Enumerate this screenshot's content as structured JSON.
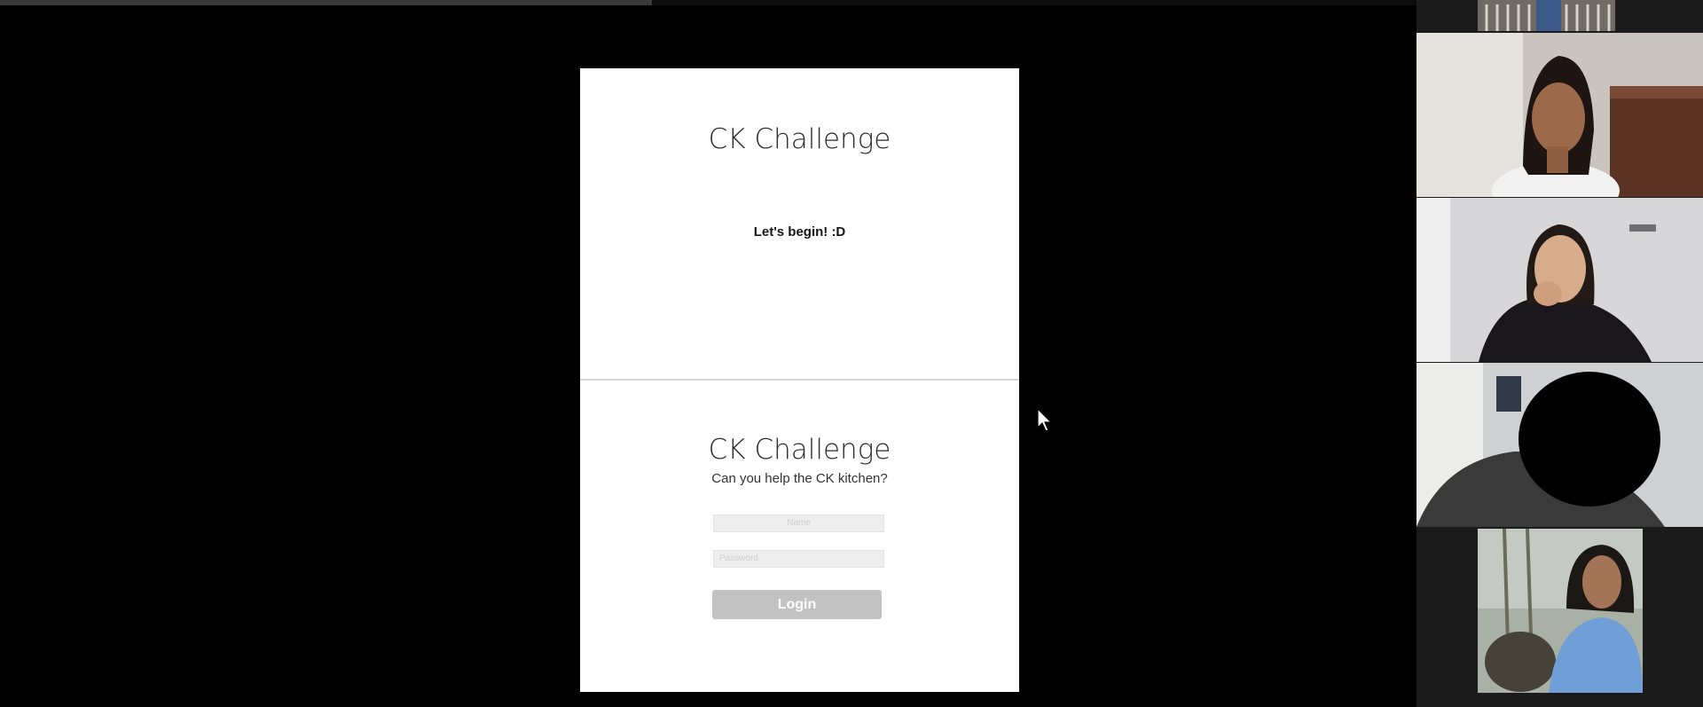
{
  "screen_share": {
    "playback_progress": 0.46,
    "slide_top": {
      "title": "CK Challenge",
      "subtitle": "Let's begin! :D"
    },
    "slide_bottom": {
      "title": "CK Challenge",
      "subtitle": "Can you help the CK kitchen?",
      "username_placeholder": "Name",
      "password_placeholder": "Password",
      "login_label": "Login"
    }
  },
  "participants": [
    {
      "role": "video-tile",
      "kind": "partial-top"
    },
    {
      "role": "video-tile",
      "kind": "speaker"
    },
    {
      "role": "video-tile",
      "kind": "participant"
    },
    {
      "role": "video-tile",
      "kind": "redacted"
    },
    {
      "role": "video-tile",
      "kind": "participant"
    }
  ],
  "colors": {
    "background": "#000000",
    "slide_background": "#ffffff",
    "login_button": "#c2c2c2",
    "panel_background": "#1b1b1b"
  }
}
